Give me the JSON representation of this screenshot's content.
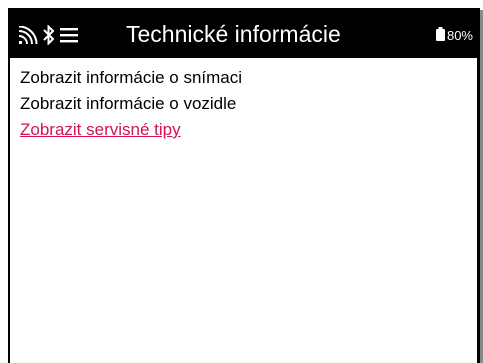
{
  "header": {
    "title": "Technické informácie",
    "battery": "80%"
  },
  "status_icons": [
    "wifi-icon",
    "bluetooth-icon",
    "menu-icon",
    "battery-icon"
  ],
  "menu": {
    "items": [
      {
        "label": "Zobrazit informácie o snímaci",
        "active": false
      },
      {
        "label": "Zobrazit informácie o vozidle",
        "active": false
      },
      {
        "label": "Zobrazit servisné tipy",
        "active": true
      }
    ]
  },
  "colors": {
    "header_bg": "#000000",
    "header_text": "#ffffff",
    "active_item": "#d21452",
    "text": "#000000"
  }
}
